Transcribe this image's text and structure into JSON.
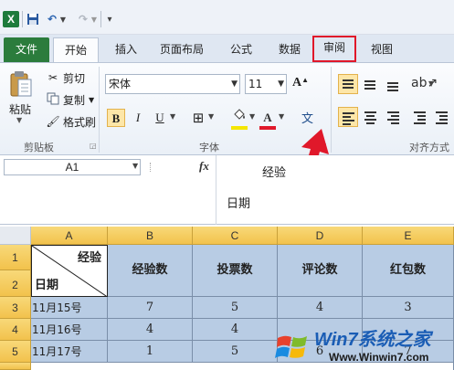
{
  "quick_access": {
    "app_logo": "X",
    "icons": [
      "excel-icon",
      "save-icon",
      "undo-icon",
      "redo-icon",
      "customize-icon"
    ]
  },
  "tabs": {
    "file": "文件",
    "home": "开始",
    "insert": "插入",
    "page_layout": "页面布局",
    "formulas": "公式",
    "data": "数据",
    "review": "审阅",
    "view": "视图",
    "active": "开始",
    "highlighted": "审阅",
    "highlight_color": "#e0182a"
  },
  "ribbon": {
    "clipboard": {
      "paste": "粘贴",
      "cut": "剪切",
      "copy": "复制",
      "format_painter": "格式刷",
      "group_label": "剪贴板"
    },
    "font": {
      "font_name": "宋体",
      "font_size": "11",
      "bold": "B",
      "italic": "I",
      "underline": "U",
      "font_color_glyph": "A",
      "phonetic": "文",
      "group_label": "字体",
      "fill_color": "#f5e600",
      "font_color": "#e0182a"
    },
    "alignment": {
      "group_label": "对齐方式"
    }
  },
  "formula_bar": {
    "name_box": "A1",
    "fx": "fx",
    "line1": "经验",
    "line2": "日期"
  },
  "sheet": {
    "columns": [
      "A",
      "B",
      "C",
      "D",
      "E"
    ],
    "rows": [
      "1",
      "2",
      "3",
      "4",
      "5"
    ],
    "diag_top": "经验",
    "diag_bottom": "日期",
    "headers": [
      "经验数",
      "投票数",
      "评论数",
      "红包数"
    ],
    "data": [
      [
        "11月15号",
        "7",
        "5",
        "4",
        "3"
      ],
      [
        "11月16号",
        "4",
        "4",
        "",
        ""
      ],
      [
        "11月17号",
        "1",
        "5",
        "6",
        "7"
      ]
    ],
    "cell_fill": "#b8cce4"
  },
  "watermark": {
    "title": "Win7系统之家",
    "url": "Www.Winwin7.com"
  }
}
